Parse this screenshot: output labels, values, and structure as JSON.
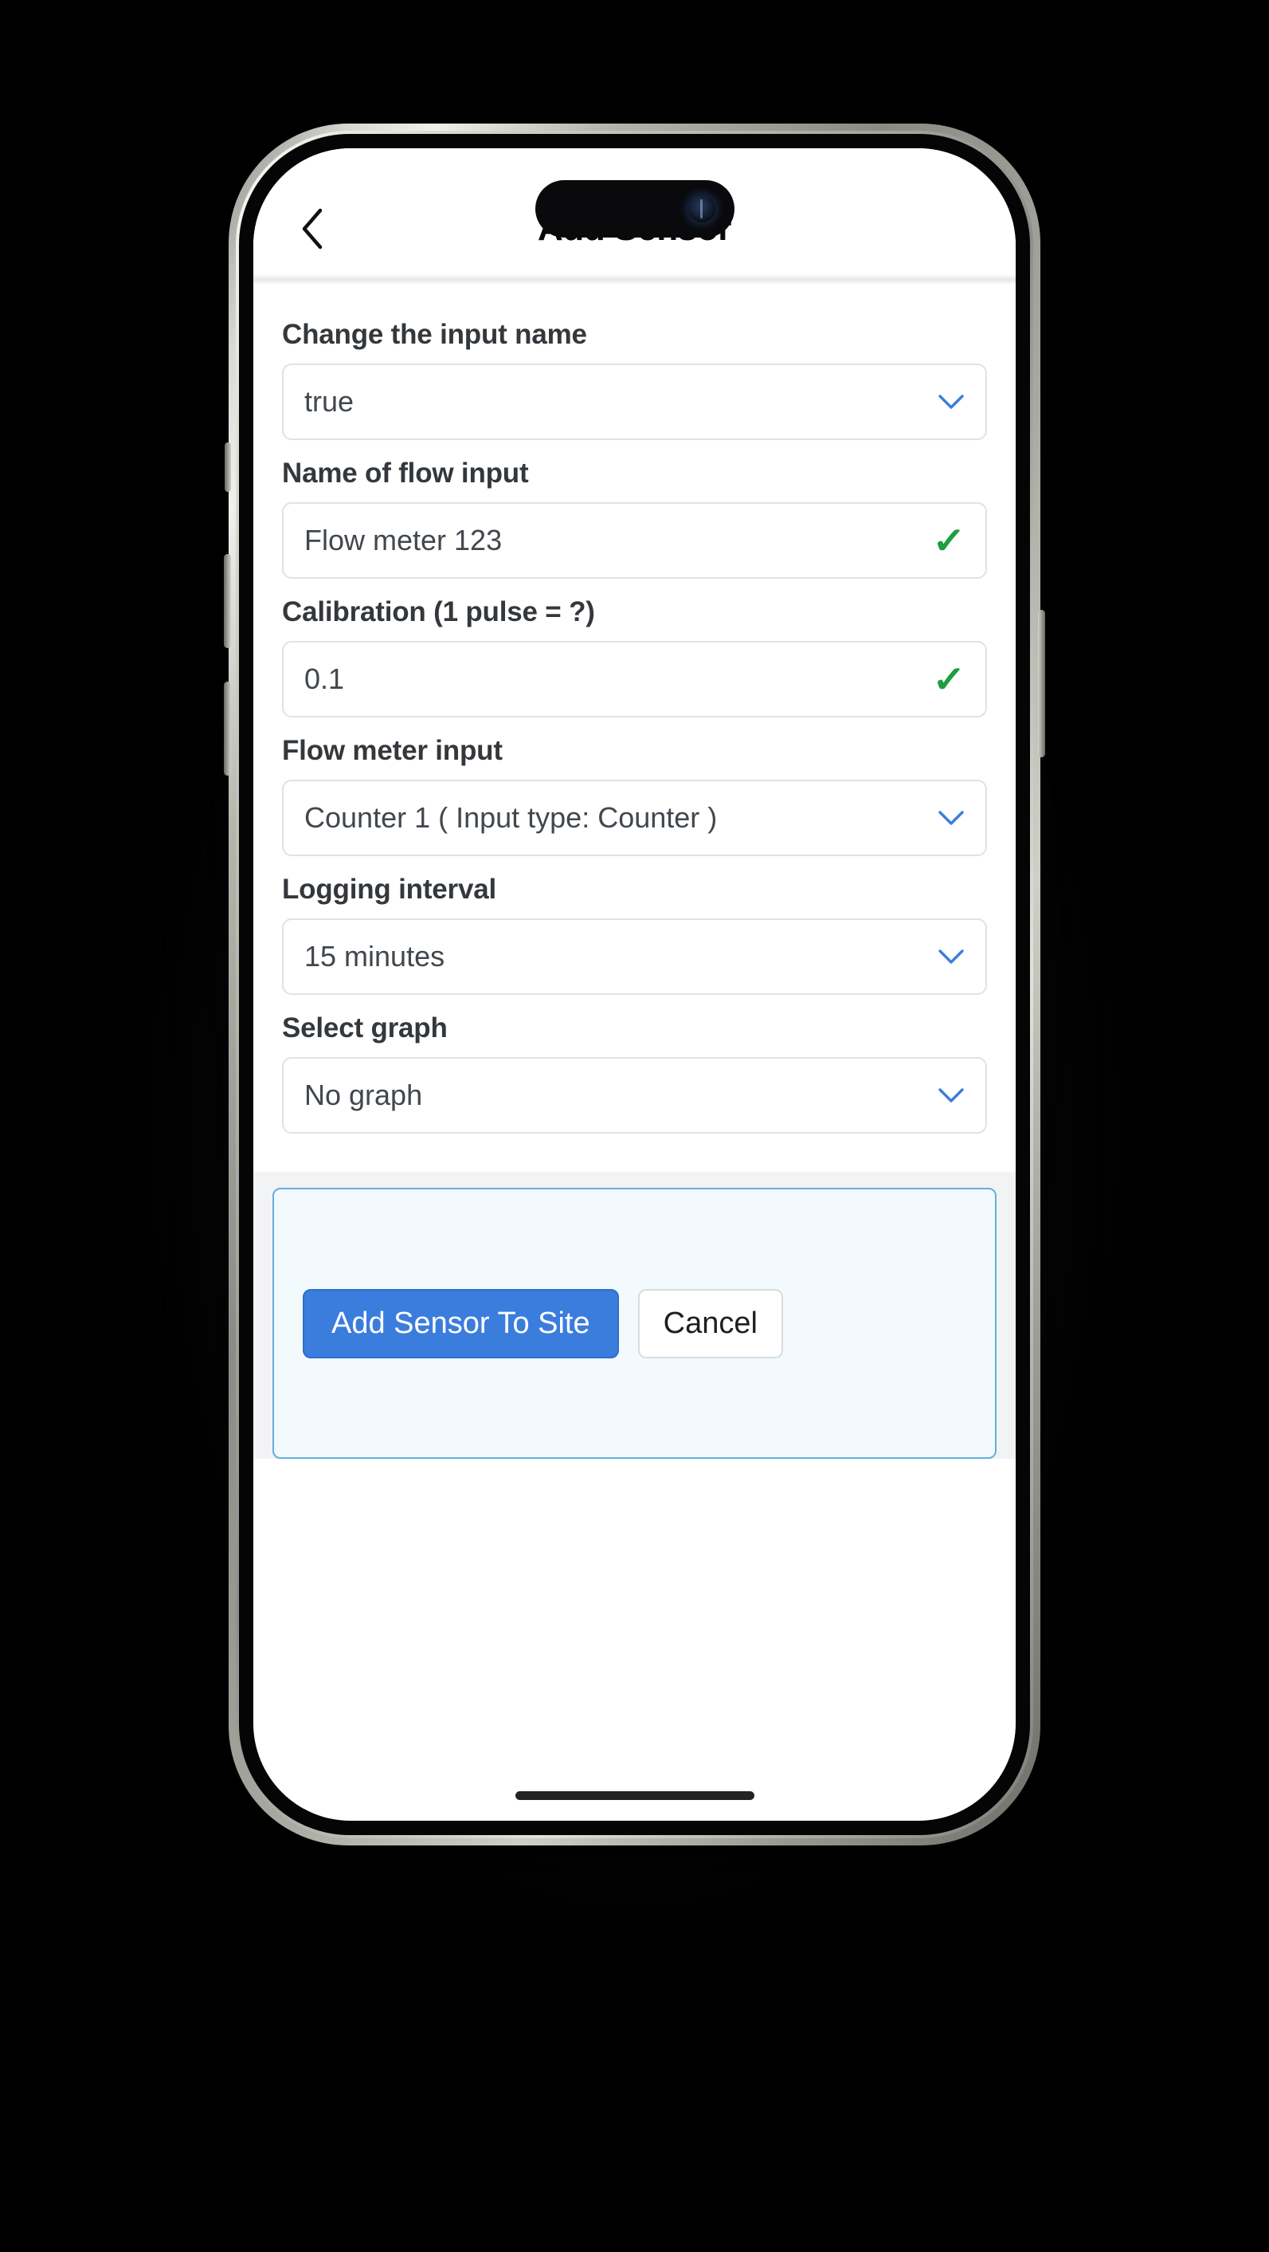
{
  "header": {
    "back_icon": "chevron-left-icon",
    "title": "Add Sensor"
  },
  "form": {
    "fields": [
      {
        "label": "Change the input name",
        "type": "select",
        "value": "true",
        "icon": "chevron-down-icon"
      },
      {
        "label": "Name of flow input",
        "type": "text",
        "value": "Flow meter 123",
        "icon": "check-icon"
      },
      {
        "label": "Calibration (1 pulse = ?)",
        "type": "text",
        "value": "0.1",
        "icon": "check-icon"
      },
      {
        "label": "Flow meter input",
        "type": "select",
        "value": "Counter 1 ( Input type: Counter )",
        "icon": "chevron-down-icon"
      },
      {
        "label": "Logging interval",
        "type": "select",
        "value": "15 minutes",
        "icon": "chevron-down-icon"
      },
      {
        "label": "Select graph",
        "type": "select",
        "value": "No graph",
        "icon": "chevron-down-icon"
      }
    ]
  },
  "footer": {
    "submit_label": "Add Sensor To Site",
    "cancel_label": "Cancel"
  },
  "colors": {
    "primary": "#3b7ddd",
    "panel_border": "#61b0e0",
    "panel_bg": "#f3fafd",
    "check_green": "#1f9d3f",
    "chevron_blue": "#3b7ddd",
    "label_text": "#34383c",
    "value_text": "#41474d",
    "field_border": "#dfe2e6"
  }
}
